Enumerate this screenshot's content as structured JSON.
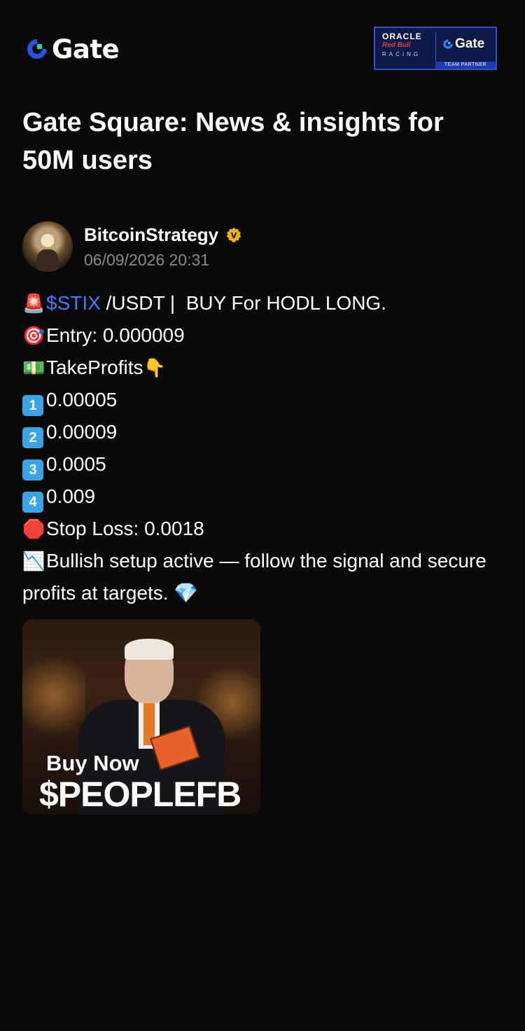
{
  "header": {
    "brand": "Gate",
    "partner_badge": {
      "oracle": "ORACLE",
      "redbull": "Red Bull",
      "racing": "RACING",
      "gate": "Gate",
      "label": "TEAM PARTNER"
    }
  },
  "page": {
    "title": "Gate Square: News & insights for 50M users"
  },
  "post": {
    "author": "BitcoinStrategy",
    "verified_badge": "V",
    "timestamp": "06/09/2026 20:31",
    "lines": {
      "l1_emoji": "🚨",
      "l1_ticker": "$STIX",
      "l1_text": " /USDT |  BUY For HODL LONG.",
      "l2_emoji": "🎯",
      "l2_text": "Entry: 0.000009",
      "l3_emoji": "💵",
      "l3_text": "TakeProfits",
      "l3_emoji_end": "👇",
      "tp1_key": "1",
      "tp1": "0.00005",
      "tp2_key": "2",
      "tp2": "0.00009",
      "tp3_key": "3",
      "tp3": "0.0005",
      "tp4_key": "4",
      "tp4": "0.009",
      "stop_emoji": "🛑",
      "stop_text": "Stop Loss: 0.0018",
      "last_emoji": "📉",
      "last_text": "Bullish setup active — follow the signal and secure profits at targets. ",
      "last_emoji_end": "💎"
    },
    "image": {
      "headline": "Buy Now",
      "coin": "$PEOPLEFB"
    }
  },
  "colors": {
    "background": "#0a0a0a",
    "ticker": "#3d7cff",
    "verified": "#f2b20c",
    "timestamp": "#8a8a8a"
  }
}
